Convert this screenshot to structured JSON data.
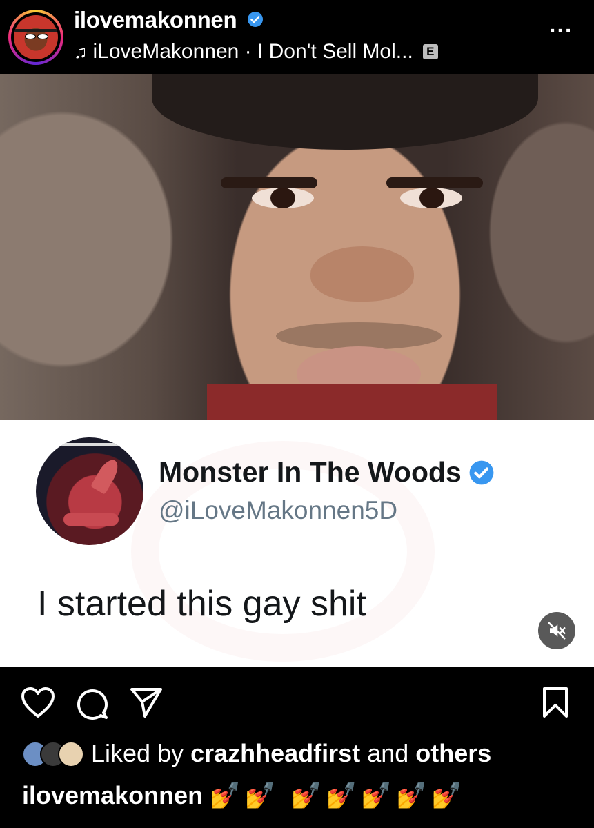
{
  "header": {
    "username": "ilovemakonnen",
    "music_note": "♫",
    "music_text": "iLoveMakonnen · I Don't Sell Mol...",
    "explicit_label": "E",
    "more_label": "..."
  },
  "tweet": {
    "display_name": "Monster In The Woods",
    "handle": "@iLoveMakonnen5D",
    "text": "I started this gay shit"
  },
  "likes": {
    "prefix": "Liked by",
    "user": "crazhheadfirst",
    "middle": "and",
    "suffix": "others"
  },
  "caption": {
    "username": "ilovemakonnen",
    "text": "💅💅 💅💅💅💅💅"
  },
  "icons": {
    "like": "heart-icon",
    "comment": "comment-icon",
    "share": "send-icon",
    "save": "bookmark-icon",
    "mute": "muted-speaker-icon"
  },
  "colors": {
    "verified": "#3897f0",
    "background": "#000000",
    "tweet_background": "#ffffff",
    "handle": "#657786"
  }
}
